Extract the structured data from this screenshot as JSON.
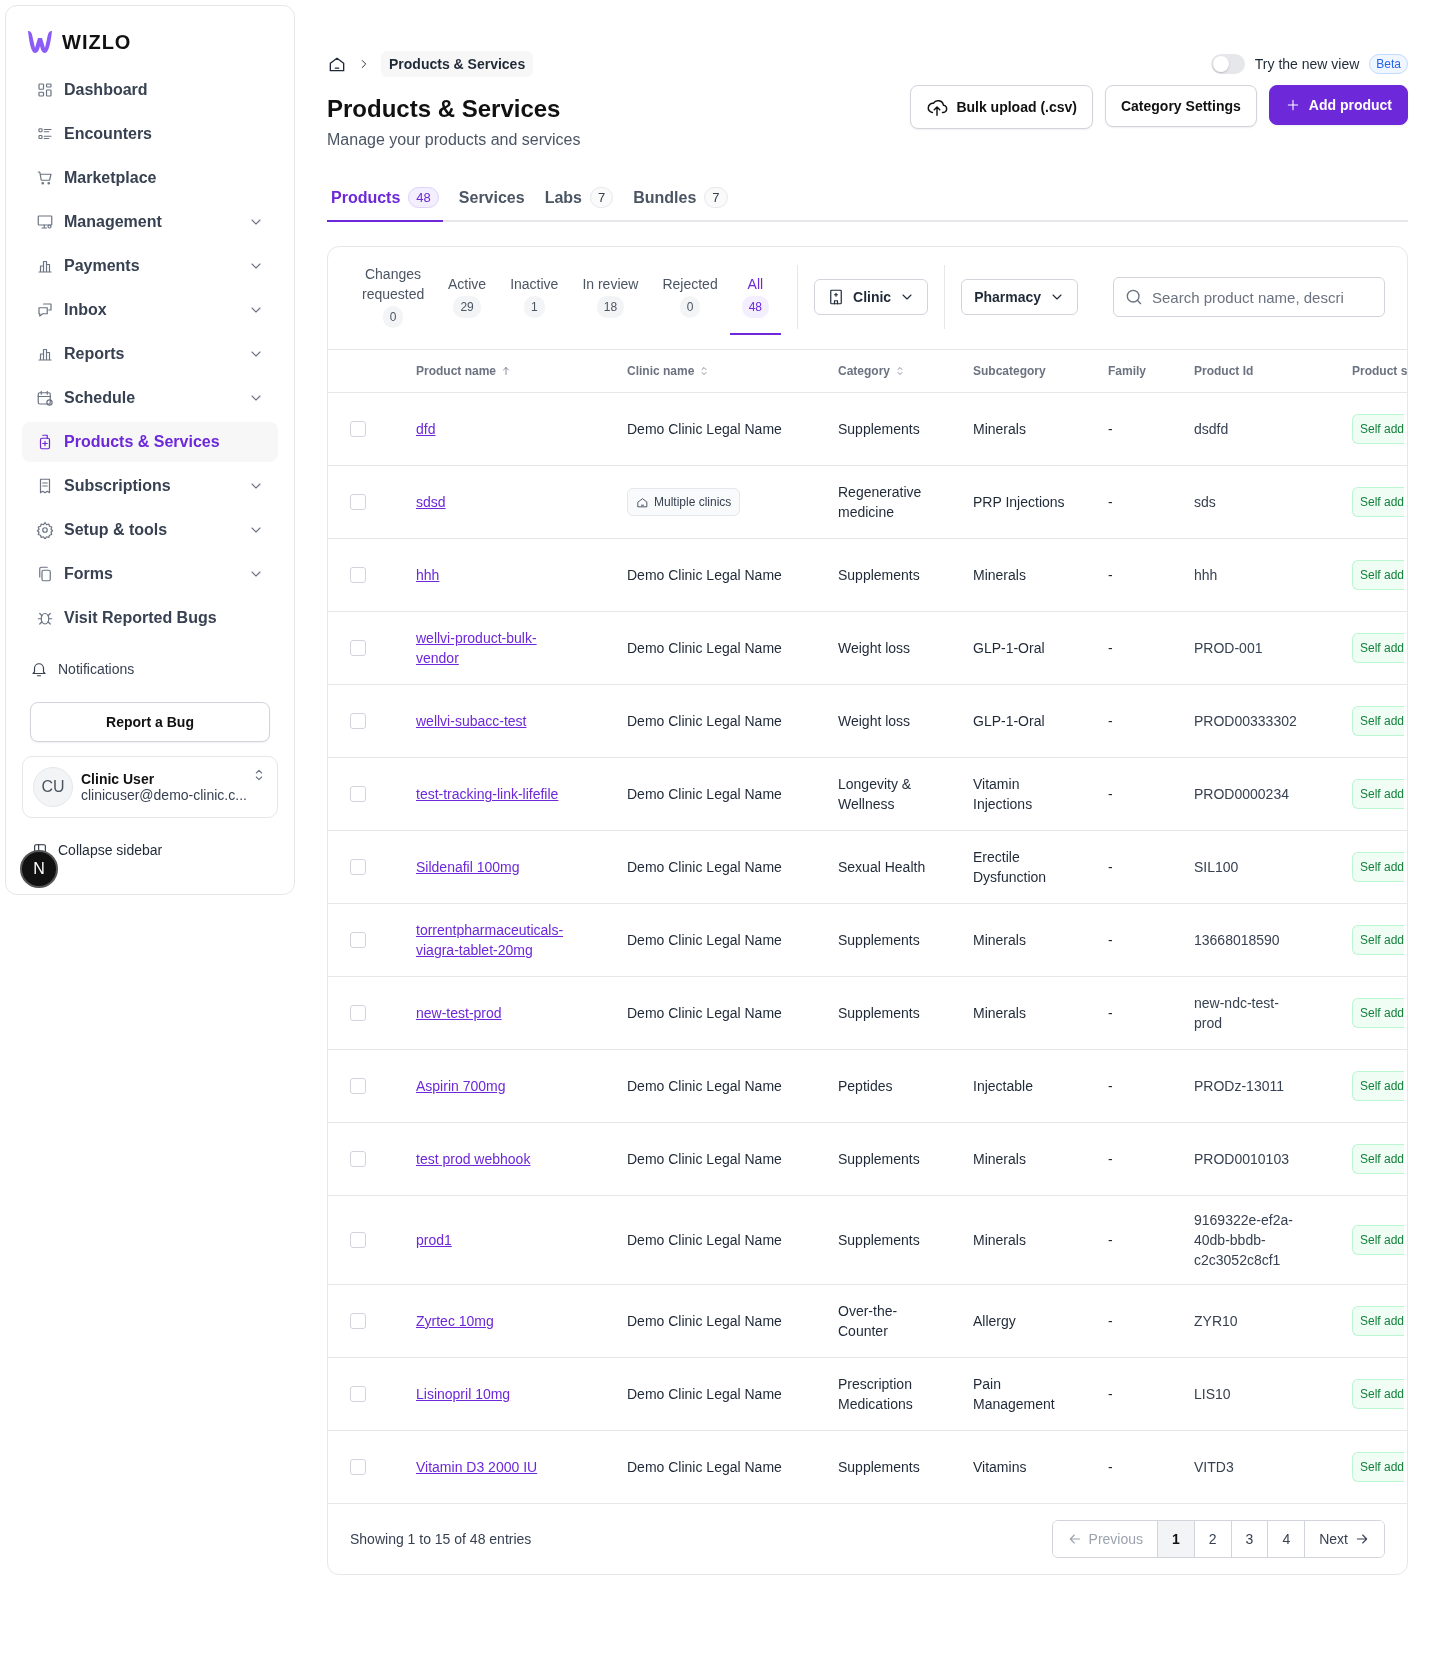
{
  "sidebar": {
    "logo": "WIZLO",
    "items": [
      {
        "label": "Dashboard",
        "expandable": false,
        "selected": false
      },
      {
        "label": "Encounters",
        "expandable": false,
        "selected": false
      },
      {
        "label": "Marketplace",
        "expandable": false,
        "selected": false
      },
      {
        "label": "Management",
        "expandable": true,
        "selected": false
      },
      {
        "label": "Payments",
        "expandable": true,
        "selected": false
      },
      {
        "label": "Inbox",
        "expandable": true,
        "selected": false
      },
      {
        "label": "Reports",
        "expandable": true,
        "selected": false
      },
      {
        "label": "Schedule",
        "expandable": true,
        "selected": false
      },
      {
        "label": "Products & Services",
        "expandable": false,
        "selected": true
      },
      {
        "label": "Subscriptions",
        "expandable": true,
        "selected": false
      },
      {
        "label": "Setup & tools",
        "expandable": true,
        "selected": false
      },
      {
        "label": "Forms",
        "expandable": true,
        "selected": false
      },
      {
        "label": "Visit Reported Bugs",
        "expandable": false,
        "selected": false
      }
    ],
    "notifications": "Notifications",
    "report_button": "Report a Bug",
    "user": {
      "initials": "CU",
      "name": "Clinic User",
      "email": "clinicuser@demo-clinic.c..."
    },
    "dev_badge": "N",
    "collapse": "Collapse sidebar"
  },
  "breadcrumb": "Products & Services",
  "new_view": {
    "label": "Try the new view",
    "on": false,
    "badge": "Beta"
  },
  "title": "Products & Services",
  "subtitle": "Manage your products and services",
  "buttons": [
    {
      "label": "Bulk upload (.csv)",
      "kind": "upload"
    },
    {
      "label": "Category Settings",
      "kind": "plain"
    },
    {
      "label": "Add product",
      "kind": "primary"
    }
  ],
  "tabs": [
    {
      "label": "Products",
      "count": "48",
      "selected": true
    },
    {
      "label": "Services",
      "selected": false
    },
    {
      "label": "Labs",
      "count": "7",
      "selected": false
    },
    {
      "label": "Bundles",
      "count": "7",
      "selected": false
    }
  ],
  "status_filters": [
    {
      "label": "Changes requested",
      "count": "0",
      "selected": false
    },
    {
      "label": "Active",
      "count": "29",
      "selected": false
    },
    {
      "label": "Inactive",
      "count": "1",
      "selected": false
    },
    {
      "label": "In review",
      "count": "18",
      "selected": false
    },
    {
      "label": "Rejected",
      "count": "0",
      "selected": false
    },
    {
      "label": "All",
      "count": "48",
      "selected": true
    }
  ],
  "clinic_filter": "Clinic",
  "pharmacy_filter": "Pharmacy",
  "search": {
    "placeholder": "Search product name, descri"
  },
  "table": {
    "columns": [
      {
        "label": "Product name",
        "kind": "sorted"
      },
      {
        "label": "Clinic name",
        "kind": "sortable"
      },
      {
        "label": "Category",
        "kind": "sortable"
      },
      {
        "label": "Subcategory",
        "kind": "plain"
      },
      {
        "label": "Family",
        "kind": "plain"
      },
      {
        "label": "Product Id",
        "kind": "plain"
      },
      {
        "label": "Product s",
        "kind": "plain"
      }
    ],
    "rows": [
      {
        "checked": false,
        "name": "dfd",
        "clinic": {
          "label": "Demo Clinic Legal Name",
          "kind": "text"
        },
        "category": "Supplements",
        "subcategory": "Minerals",
        "family": "-",
        "id": "dsdfd",
        "status": "Self add"
      },
      {
        "checked": false,
        "name": "sdsd",
        "clinic": {
          "label": "Multiple clinics",
          "kind": "tag"
        },
        "category": "Regenerative medicine",
        "subcategory": "PRP Injections",
        "family": "-",
        "id": "sds",
        "status": "Self add"
      },
      {
        "checked": false,
        "name": "hhh",
        "clinic": {
          "label": "Demo Clinic Legal Name",
          "kind": "text"
        },
        "category": "Supplements",
        "subcategory": "Minerals",
        "family": "-",
        "id": "hhh",
        "status": "Self add"
      },
      {
        "checked": false,
        "name": "wellvi-product-bulk-vendor",
        "clinic": {
          "label": "Demo Clinic Legal Name",
          "kind": "text"
        },
        "category": "Weight loss",
        "subcategory": "GLP-1-Oral",
        "family": "-",
        "id": "PROD-001",
        "status": "Self add"
      },
      {
        "checked": false,
        "name": "wellvi-subacc-test",
        "clinic": {
          "label": "Demo Clinic Legal Name",
          "kind": "text"
        },
        "category": "Weight loss",
        "subcategory": "GLP-1-Oral",
        "family": "-",
        "id": "PROD00333302",
        "status": "Self add"
      },
      {
        "checked": false,
        "name": "test-tracking-link-lifefile",
        "clinic": {
          "label": "Demo Clinic Legal Name",
          "kind": "text"
        },
        "category": "Longevity & Wellness",
        "subcategory": "Vitamin Injections",
        "family": "-",
        "id": "PROD0000234",
        "status": "Self add"
      },
      {
        "checked": false,
        "name": "Sildenafil 100mg",
        "clinic": {
          "label": "Demo Clinic Legal Name",
          "kind": "text"
        },
        "category": "Sexual Health",
        "subcategory": "Erectile Dysfunction",
        "family": "-",
        "id": "SIL100",
        "status": "Self add"
      },
      {
        "checked": false,
        "name": "torrentpharmaceuticals-viagra-tablet-20mg",
        "clinic": {
          "label": "Demo Clinic Legal Name",
          "kind": "text"
        },
        "category": "Supplements",
        "subcategory": "Minerals",
        "family": "-",
        "id": "13668018590",
        "status": "Self add"
      },
      {
        "checked": false,
        "name": "new-test-prod",
        "clinic": {
          "label": "Demo Clinic Legal Name",
          "kind": "text"
        },
        "category": "Supplements",
        "subcategory": "Minerals",
        "family": "-",
        "id": "new-ndc-test-prod",
        "status": "Self add"
      },
      {
        "checked": false,
        "name": "Aspirin 700mg",
        "clinic": {
          "label": "Demo Clinic Legal Name",
          "kind": "text"
        },
        "category": "Peptides",
        "subcategory": "Injectable",
        "family": "-",
        "id": "PRODz-13011",
        "status": "Self add"
      },
      {
        "checked": false,
        "name": "test prod webhook",
        "clinic": {
          "label": "Demo Clinic Legal Name",
          "kind": "text"
        },
        "category": "Supplements",
        "subcategory": "Minerals",
        "family": "-",
        "id": "PROD0010103",
        "status": "Self add"
      },
      {
        "checked": false,
        "name": "prod1",
        "clinic": {
          "label": "Demo Clinic Legal Name",
          "kind": "text"
        },
        "category": "Supplements",
        "subcategory": "Minerals",
        "family": "-",
        "id": "9169322e-ef2a-40db-bbdb-c2c3052c8cf1",
        "status": "Self add"
      },
      {
        "checked": false,
        "name": "Zyrtec 10mg",
        "clinic": {
          "label": "Demo Clinic Legal Name",
          "kind": "text"
        },
        "category": "Over-the-Counter",
        "subcategory": "Allergy",
        "family": "-",
        "id": "ZYR10",
        "status": "Self add"
      },
      {
        "checked": false,
        "name": "Lisinopril 10mg",
        "clinic": {
          "label": "Demo Clinic Legal Name",
          "kind": "text"
        },
        "category": "Prescription Medications",
        "subcategory": "Pain Management",
        "family": "-",
        "id": "LIS10",
        "status": "Self add"
      },
      {
        "checked": false,
        "name": "Vitamin D3 2000 IU",
        "clinic": {
          "label": "Demo Clinic Legal Name",
          "kind": "text"
        },
        "category": "Supplements",
        "subcategory": "Vitamins",
        "family": "-",
        "id": "VITD3",
        "status": "Self add"
      }
    ]
  },
  "footer": {
    "summary": "Showing 1 to 15 of 48 entries",
    "previous": {
      "label": "Previous",
      "disabled": true
    },
    "pages": [
      {
        "label": "1",
        "selected": true
      },
      {
        "label": "2",
        "selected": false
      },
      {
        "label": "3",
        "selected": false
      },
      {
        "label": "4",
        "selected": false
      }
    ],
    "next": {
      "label": "Next",
      "disabled": false
    }
  }
}
